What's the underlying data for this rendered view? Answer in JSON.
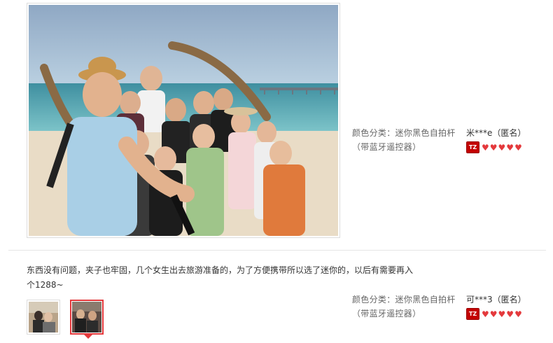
{
  "reviews": [
    {
      "sku_label": "颜色分类：迷你黑色自拍杆（带蓝牙遥控器）",
      "user_name": "米***e（匿名）",
      "badge_text": "TZ",
      "hearts": 5,
      "photo_icon": "group-selfie-beach-photo"
    },
    {
      "content": "东西没有问题，夹子也牢固，几个女生出去旅游准备的，为了方便携带所以选了迷你的，以后有需要再入个1288~",
      "sku_label": "颜色分类：迷你黑色自拍杆（带蓝牙遥控器）",
      "user_name": "可***3（匿名）",
      "badge_text": "TZ",
      "hearts": 5,
      "thumbnails": [
        "photo-thumbnail-1",
        "photo-thumbnail-2"
      ]
    }
  ],
  "colors": {
    "accent": "#e4393c",
    "badge": "#c40000",
    "divider": "#e6e6e6"
  }
}
